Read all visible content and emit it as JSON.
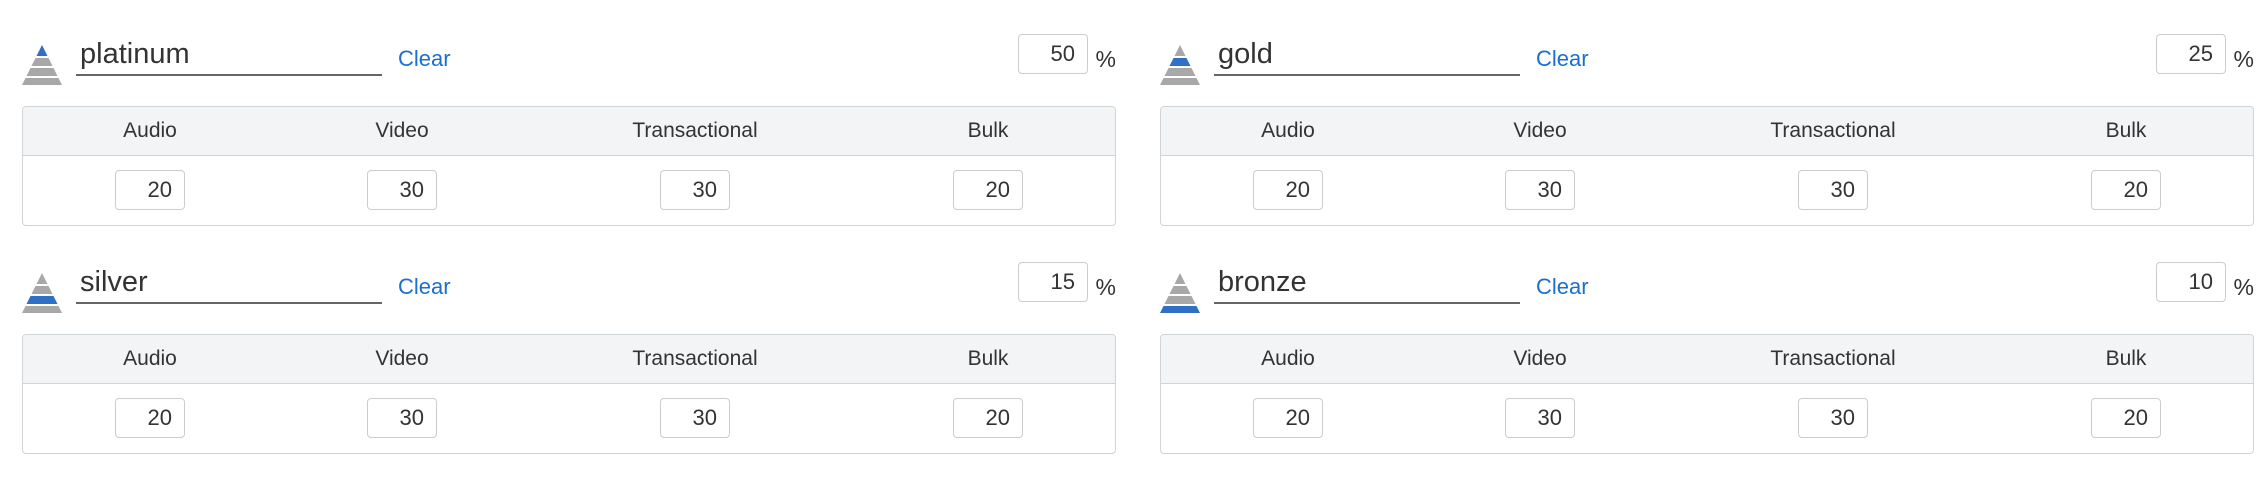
{
  "colors": {
    "accent": "#1a6fd1",
    "pyramid_grey": "#a8a8a8",
    "pyramid_active": "#2f6fc5",
    "table_border": "#cfd4d8",
    "table_header_bg": "#f3f4f5"
  },
  "tiers": [
    {
      "icon": "pyramid-top-icon",
      "name": "platinum",
      "clear_label": "Clear",
      "percent": "50",
      "percent_sign": "%",
      "columns": [
        "Audio",
        "Video",
        "Transactional",
        "Bulk"
      ],
      "values": [
        "20",
        "30",
        "30",
        "20"
      ]
    },
    {
      "icon": "pyramid-upper-middle-icon",
      "name": "gold",
      "clear_label": "Clear",
      "percent": "25",
      "percent_sign": "%",
      "columns": [
        "Audio",
        "Video",
        "Transactional",
        "Bulk"
      ],
      "values": [
        "20",
        "30",
        "30",
        "20"
      ]
    },
    {
      "icon": "pyramid-lower-middle-icon",
      "name": "silver",
      "clear_label": "Clear",
      "percent": "15",
      "percent_sign": "%",
      "columns": [
        "Audio",
        "Video",
        "Transactional",
        "Bulk"
      ],
      "values": [
        "20",
        "30",
        "30",
        "20"
      ]
    },
    {
      "icon": "pyramid-base-icon",
      "name": "bronze",
      "clear_label": "Clear",
      "percent": "10",
      "percent_sign": "%",
      "columns": [
        "Audio",
        "Video",
        "Transactional",
        "Bulk"
      ],
      "values": [
        "20",
        "30",
        "30",
        "20"
      ]
    }
  ]
}
